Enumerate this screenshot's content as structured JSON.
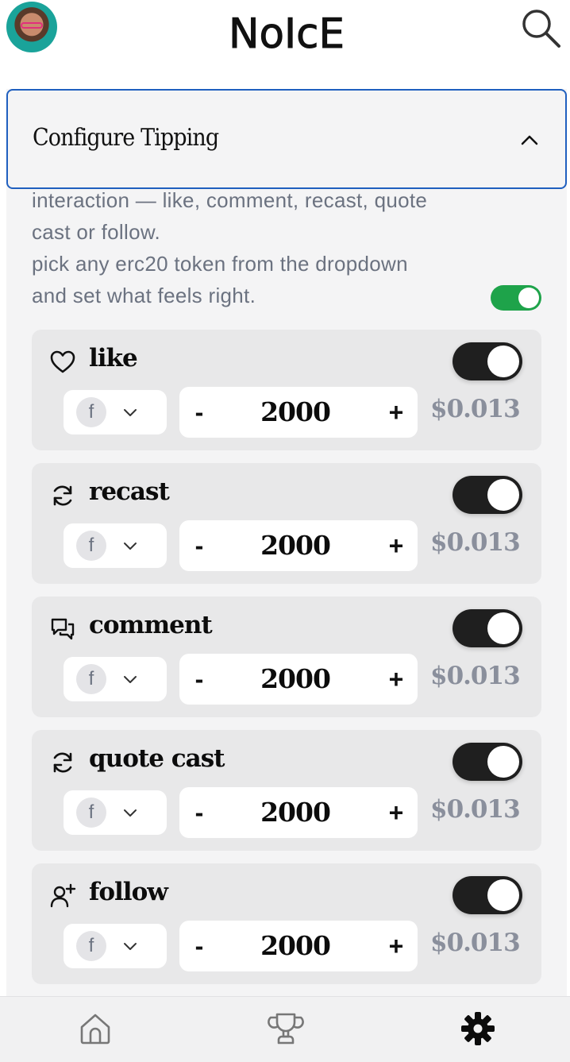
{
  "header": {
    "logo_text": "NoIcE",
    "avatar_alt": "",
    "icons": {
      "search": "search-icon"
    }
  },
  "panel": {
    "title": "Configure Tipping",
    "expanded": true,
    "description_lines": [
      "interaction — like, comment, recast, quote",
      "cast or follow.",
      "pick any erc20 token from the dropdown",
      "and set what feels right."
    ],
    "master_enabled": true,
    "accent_color": "#1ea34a"
  },
  "tips": [
    {
      "icon": "heart-icon",
      "label": "like",
      "enabled": true,
      "token": "f",
      "minus": "-",
      "amount": "2000",
      "plus": "+",
      "usd": "$0.013"
    },
    {
      "icon": "recast-icon",
      "label": "recast",
      "enabled": true,
      "token": "f",
      "minus": "-",
      "amount": "2000",
      "plus": "+",
      "usd": "$0.013"
    },
    {
      "icon": "comment-icon",
      "label": "comment",
      "enabled": true,
      "token": "f",
      "minus": "-",
      "amount": "2000",
      "plus": "+",
      "usd": "$0.013"
    },
    {
      "icon": "recast-icon",
      "label": "quote cast",
      "enabled": true,
      "token": "f",
      "minus": "-",
      "amount": "2000",
      "plus": "+",
      "usd": "$0.013"
    },
    {
      "icon": "follow-icon",
      "label": "follow",
      "enabled": true,
      "token": "f",
      "minus": "-",
      "amount": "2000",
      "plus": "+",
      "usd": "$0.013"
    }
  ],
  "bottom_nav": [
    {
      "icon": "home-icon",
      "active": false
    },
    {
      "icon": "trophy-icon",
      "active": false
    },
    {
      "icon": "settings-gear-icon",
      "active": true
    }
  ]
}
